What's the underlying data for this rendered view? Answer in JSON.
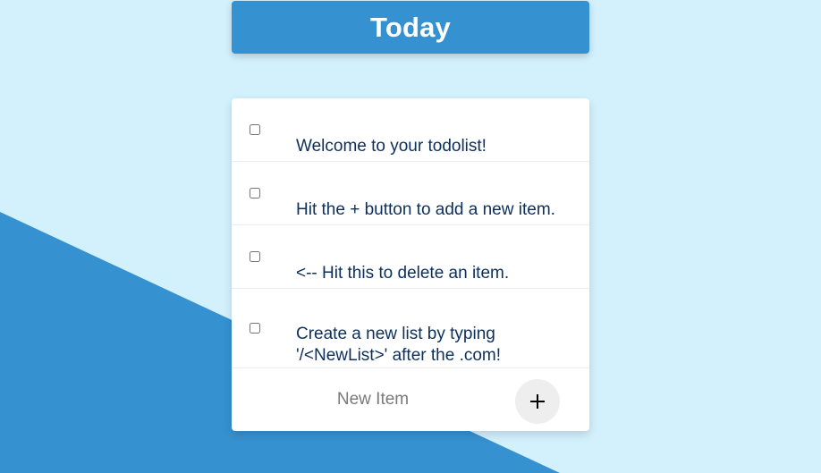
{
  "colors": {
    "page_background": "#d3f0fd",
    "accent_blue": "#3591d0",
    "card_background": "#ffffff",
    "text_navy": "#0d2f5c",
    "button_gray": "#eeeeee"
  },
  "header": {
    "title": "Today"
  },
  "todo": {
    "items": [
      {
        "text": "Welcome to your todolist!",
        "checked": false
      },
      {
        "text": "Hit the + button to add a new item.",
        "checked": false
      },
      {
        "text": "<-- Hit this to delete an item.",
        "checked": false
      },
      {
        "text": "Create a new list by typing '/<NewList>' after the .com!",
        "checked": false
      }
    ],
    "new_item": {
      "placeholder": "New Item",
      "value": "",
      "add_button_icon": "plus-icon",
      "add_button_label": "+"
    }
  }
}
